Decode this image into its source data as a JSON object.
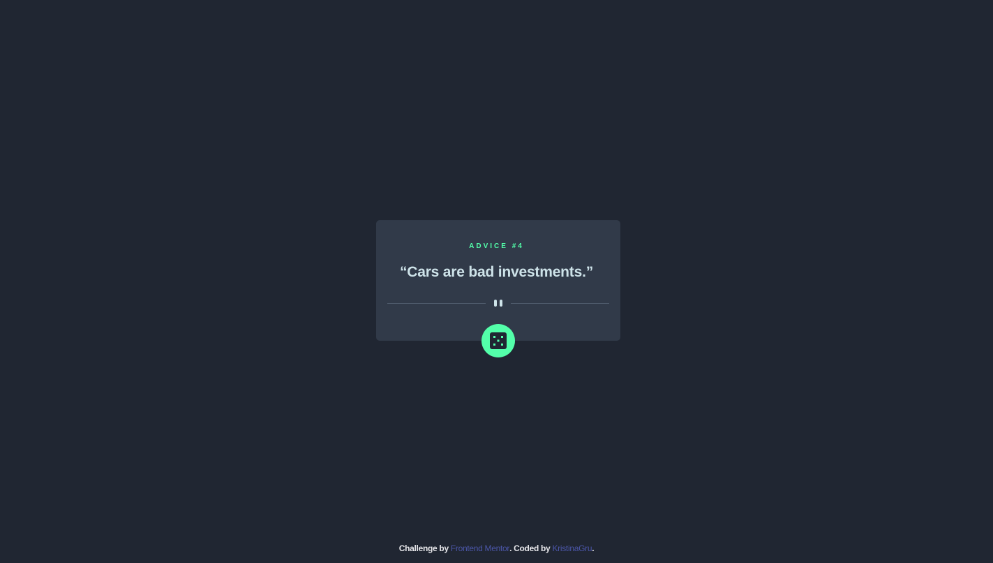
{
  "card": {
    "advice_label": "ADVICE #4",
    "quote": "“Cars are bad investments.”"
  },
  "dice_button": {
    "icon": "dice-icon"
  },
  "divider": {
    "icon": "pause-icon"
  },
  "footer": {
    "prefix": "Challenge by ",
    "challenge_link": "Frontend Mentor",
    "middle": ". Coded by ",
    "author_link": "KristinaGru",
    "suffix": "."
  },
  "colors": {
    "background": "#202632",
    "card": "#313a49",
    "accent": "#53ffaa",
    "quote_text": "#cee3e9",
    "link": "#4b56a8"
  }
}
